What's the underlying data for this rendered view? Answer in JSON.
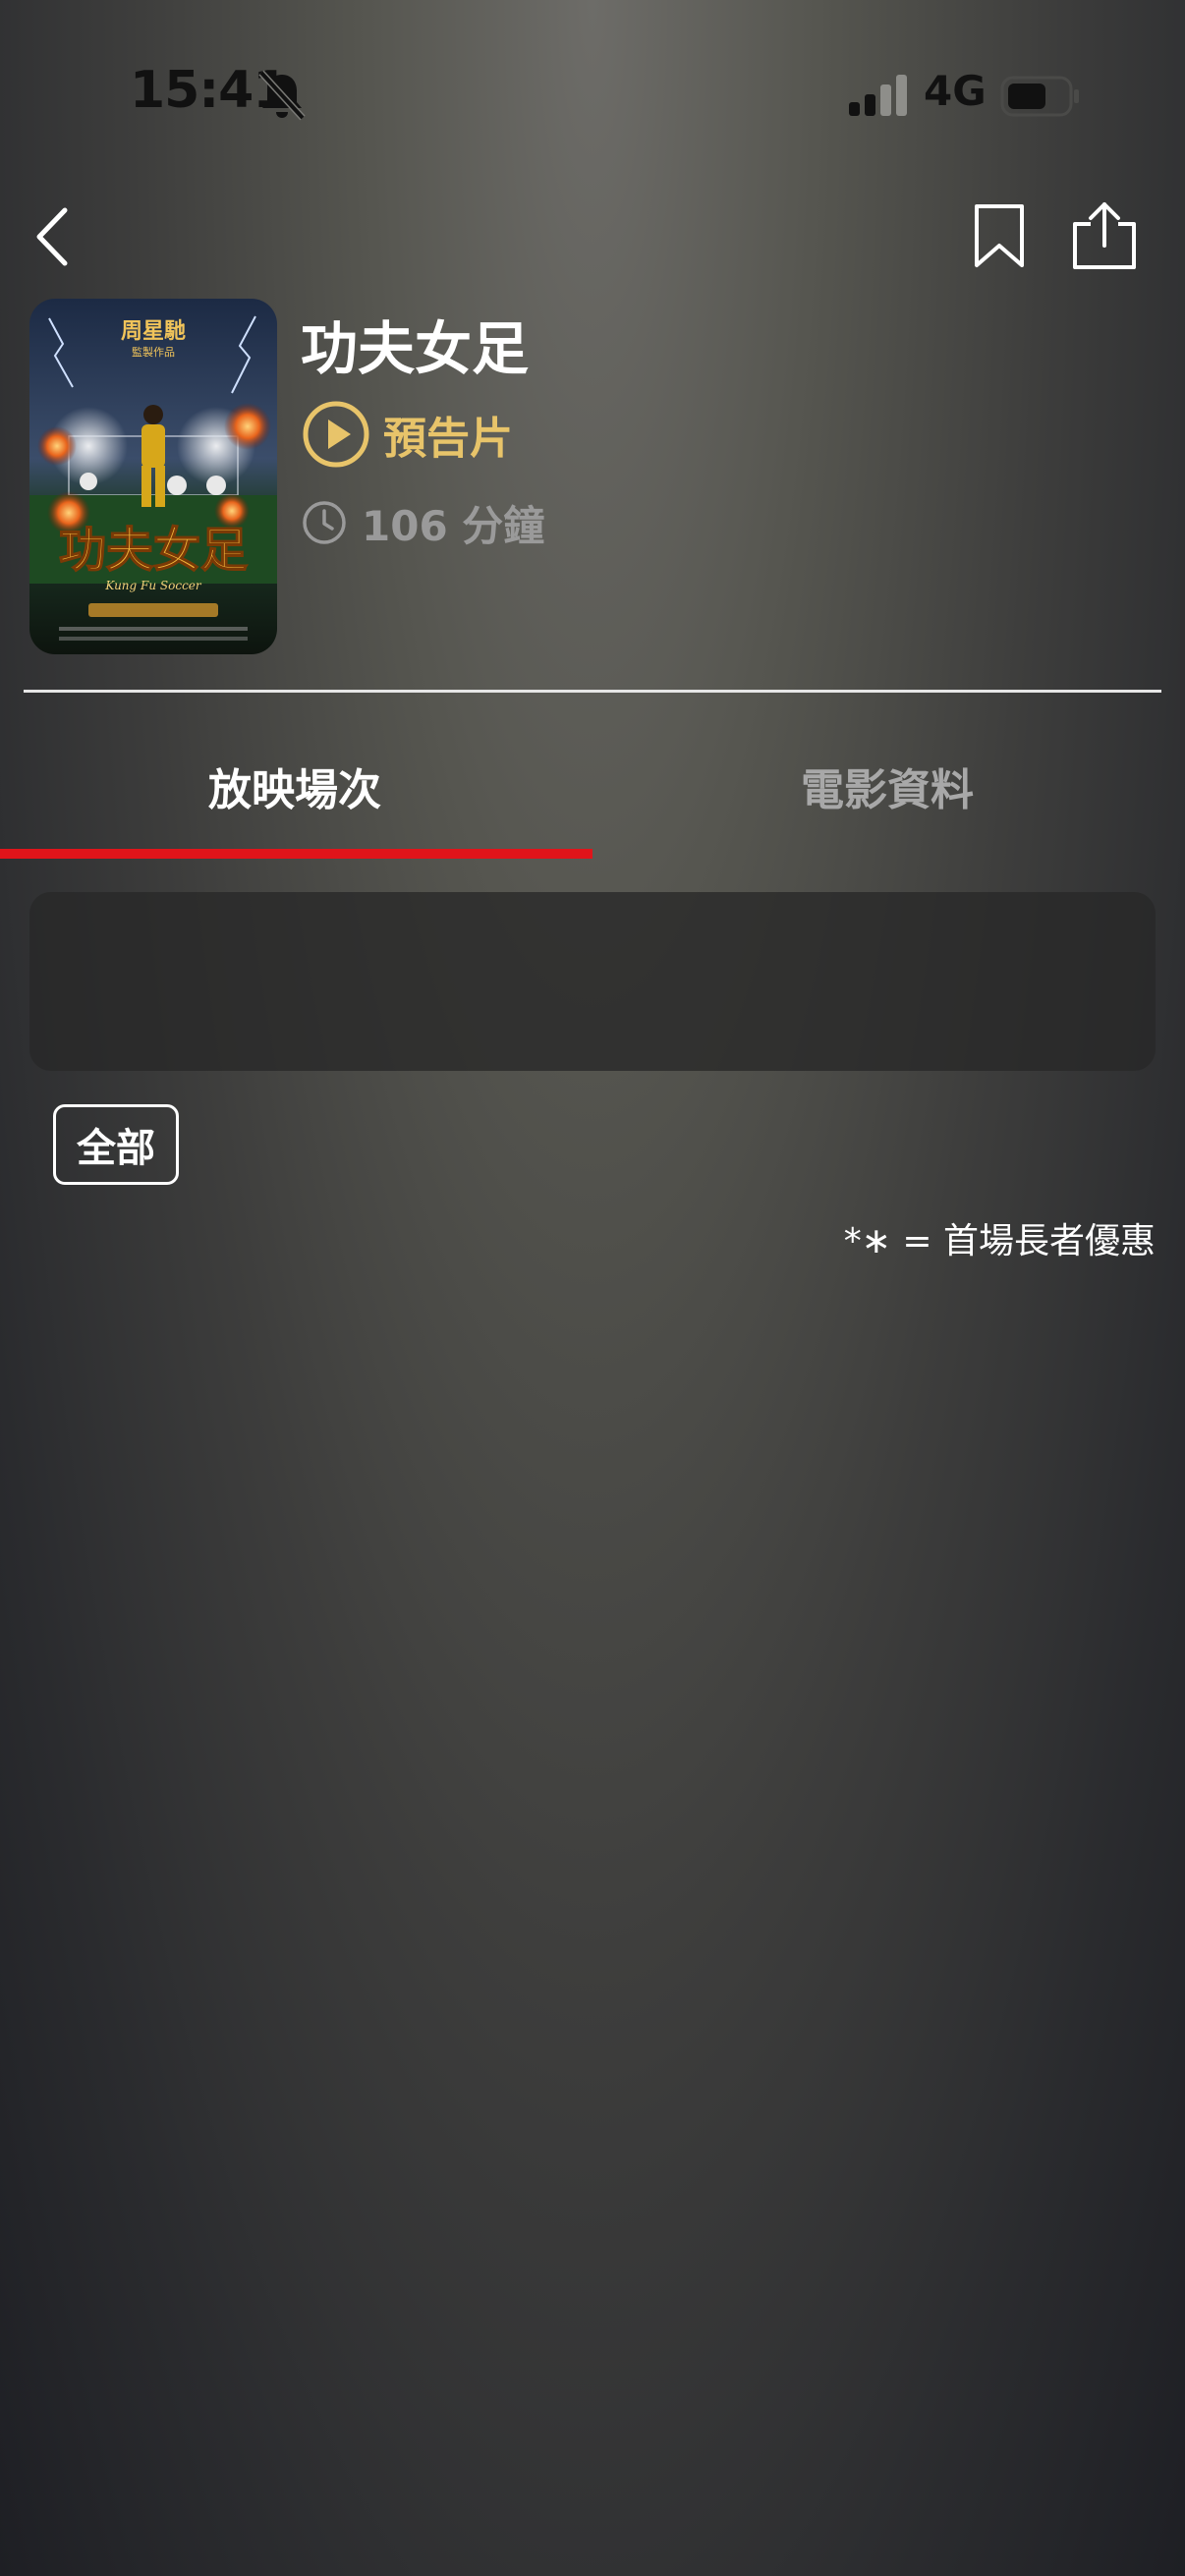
{
  "status_bar": {
    "time": "15:41",
    "network": "4G",
    "icons": [
      "bell-muted-icon",
      "signal-icon",
      "battery-icon"
    ]
  },
  "nav": {
    "icons": [
      "chevron-left-icon",
      "bookmark-icon",
      "share-icon"
    ]
  },
  "movie": {
    "title": "功夫女足",
    "trailer_label": "預告片",
    "duration_label": "106 分鐘",
    "poster_title_text": "功夫女足",
    "poster_en_text": "Kung Fu Soccer"
  },
  "tabs": [
    {
      "label": "放映場次",
      "active": true
    },
    {
      "label": "電影資料",
      "active": false
    }
  ],
  "filter": {
    "label": "全部"
  },
  "legend": "*∗ = 首場長者優惠",
  "colors": {
    "accent_red": "#e0141a",
    "trailer_gold": "#e8c46a",
    "muted_text": "#a8a8a8"
  }
}
